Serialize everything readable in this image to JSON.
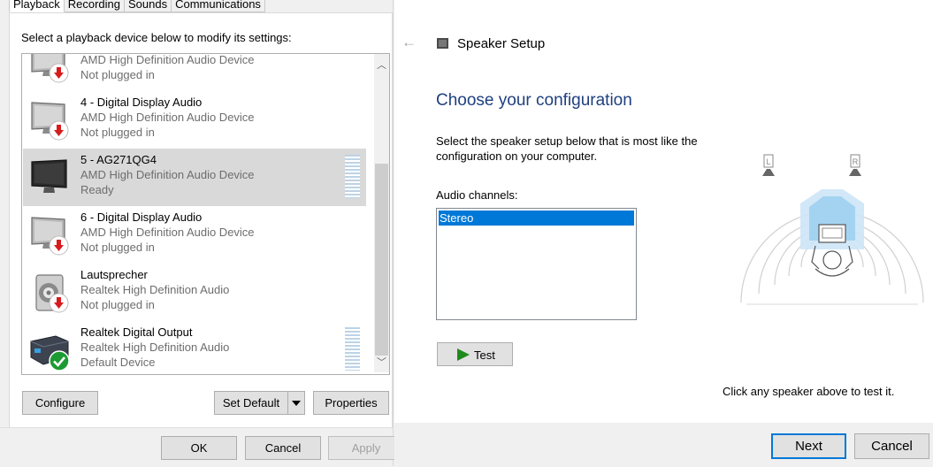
{
  "sound": {
    "tabs": [
      {
        "label": "Playback",
        "active": true
      },
      {
        "label": "Recording",
        "active": false
      },
      {
        "label": "Sounds",
        "active": false
      },
      {
        "label": "Communications",
        "active": false
      }
    ],
    "instruction": "Select a playback device below to modify its settings:",
    "devices": [
      {
        "name": "",
        "driver": "AMD High Definition Audio Device",
        "status": "Not plugged in",
        "icon": "monitor-icon",
        "badge": "unplugged-arrow-icon",
        "selected": false
      },
      {
        "name": "4 - Digital Display Audio",
        "driver": "AMD High Definition Audio Device",
        "status": "Not plugged in",
        "icon": "monitor-icon",
        "badge": "unplugged-arrow-icon",
        "selected": false
      },
      {
        "name": "5 - AG271QG4",
        "driver": "AMD High Definition Audio Device",
        "status": "Ready",
        "icon": "monitor-icon",
        "badge": "",
        "selected": true
      },
      {
        "name": "6 - Digital Display Audio",
        "driver": "AMD High Definition Audio Device",
        "status": "Not plugged in",
        "icon": "monitor-icon",
        "badge": "unplugged-arrow-icon",
        "selected": false
      },
      {
        "name": "Lautsprecher",
        "driver": "Realtek High Definition Audio",
        "status": "Not plugged in",
        "icon": "speaker-icon",
        "badge": "unplugged-arrow-icon",
        "selected": false
      },
      {
        "name": "Realtek Digital Output",
        "driver": "Realtek High Definition Audio",
        "status": "Default Device",
        "icon": "digital-output-icon",
        "badge": "default-check-icon",
        "selected": false
      }
    ],
    "buttons": {
      "configure": "Configure",
      "set_default": "Set Default",
      "properties": "Properties",
      "ok": "OK",
      "cancel": "Cancel",
      "apply": "Apply"
    }
  },
  "setup": {
    "window_title": "Speaker Setup",
    "heading": "Choose your configuration",
    "description": "Select the speaker setup below that is most like the configuration on your computer.",
    "channels_label": "Audio channels:",
    "channels": [
      "Stereo"
    ],
    "selected_channel": "Stereo",
    "test_button": "Test",
    "hint": "Click any speaker above to test it.",
    "speaker_labels": {
      "left": "L",
      "right": "R"
    },
    "next_button": "Next",
    "cancel_button": "Cancel"
  },
  "colors": {
    "accent": "#0078d7",
    "heading": "#1f3f7f",
    "unplugged": "#d61c1c",
    "default_ok": "#1e9a32",
    "selection": "#d9d9d9"
  }
}
